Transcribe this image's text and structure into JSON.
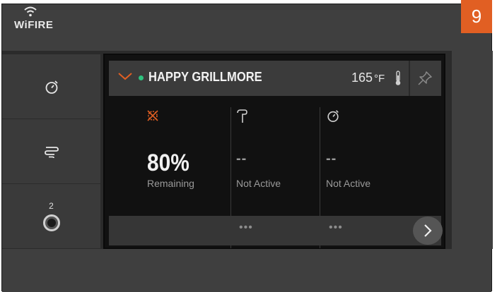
{
  "brand": {
    "logo_text": "WiFIRE",
    "accent_color": "#e15f23"
  },
  "step_badge": {
    "number": "9"
  },
  "sidebar": {
    "items": [
      {
        "icon": "timer-icon"
      },
      {
        "icon": "smoke-icon"
      },
      {
        "icon": "probe-jack-icon",
        "label": "2"
      }
    ]
  },
  "grill_card": {
    "name": "HAPPY GRILLMORE",
    "status_color": "#2ec27e",
    "temperature": "165",
    "temperature_unit": "°F",
    "columns": [
      {
        "icon": "pellet-icon",
        "value": "80%",
        "label": "Remaining"
      },
      {
        "icon": "meat-probe-icon",
        "value": "--",
        "label": "Not Active"
      },
      {
        "icon": "timer-icon",
        "value": "--",
        "label": "Not Active"
      }
    ],
    "more_indicator": "•••"
  }
}
